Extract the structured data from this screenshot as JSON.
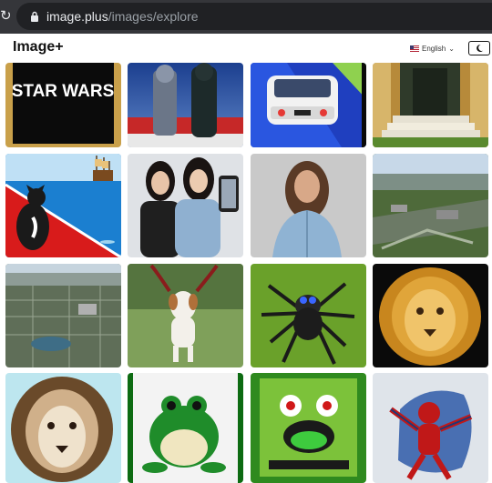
{
  "browser": {
    "url_host": "image.plus",
    "url_path": "/images/explore",
    "reload_icon": "reload-icon",
    "lock_icon": "lock-icon"
  },
  "header": {
    "logo": "Image+",
    "language": "English",
    "language_flag": "us-flag-icon",
    "theme_icon": "moon-icon"
  },
  "gallery": {
    "tiles": [
      {
        "subject": "star-wars-logo",
        "text": "STAR WARS"
      },
      {
        "subject": "star-wars-figures"
      },
      {
        "subject": "white-car"
      },
      {
        "subject": "building-doorway"
      },
      {
        "subject": "cat-and-ship"
      },
      {
        "subject": "two-women-selfie"
      },
      {
        "subject": "woman-denim-shirt"
      },
      {
        "subject": "aerial-city-1"
      },
      {
        "subject": "aerial-city-2"
      },
      {
        "subject": "horned-dog"
      },
      {
        "subject": "spider-on-grass"
      },
      {
        "subject": "lion-portrait-1"
      },
      {
        "subject": "lion-portrait-2"
      },
      {
        "subject": "frog-sitting"
      },
      {
        "subject": "frog-cartoon"
      },
      {
        "subject": "spiderman-figure"
      }
    ]
  },
  "colors": {
    "browser_bg": "#35363a",
    "omnibox_bg": "#202124",
    "url_host": "#e8eaed",
    "url_path": "#9aa0a6"
  }
}
